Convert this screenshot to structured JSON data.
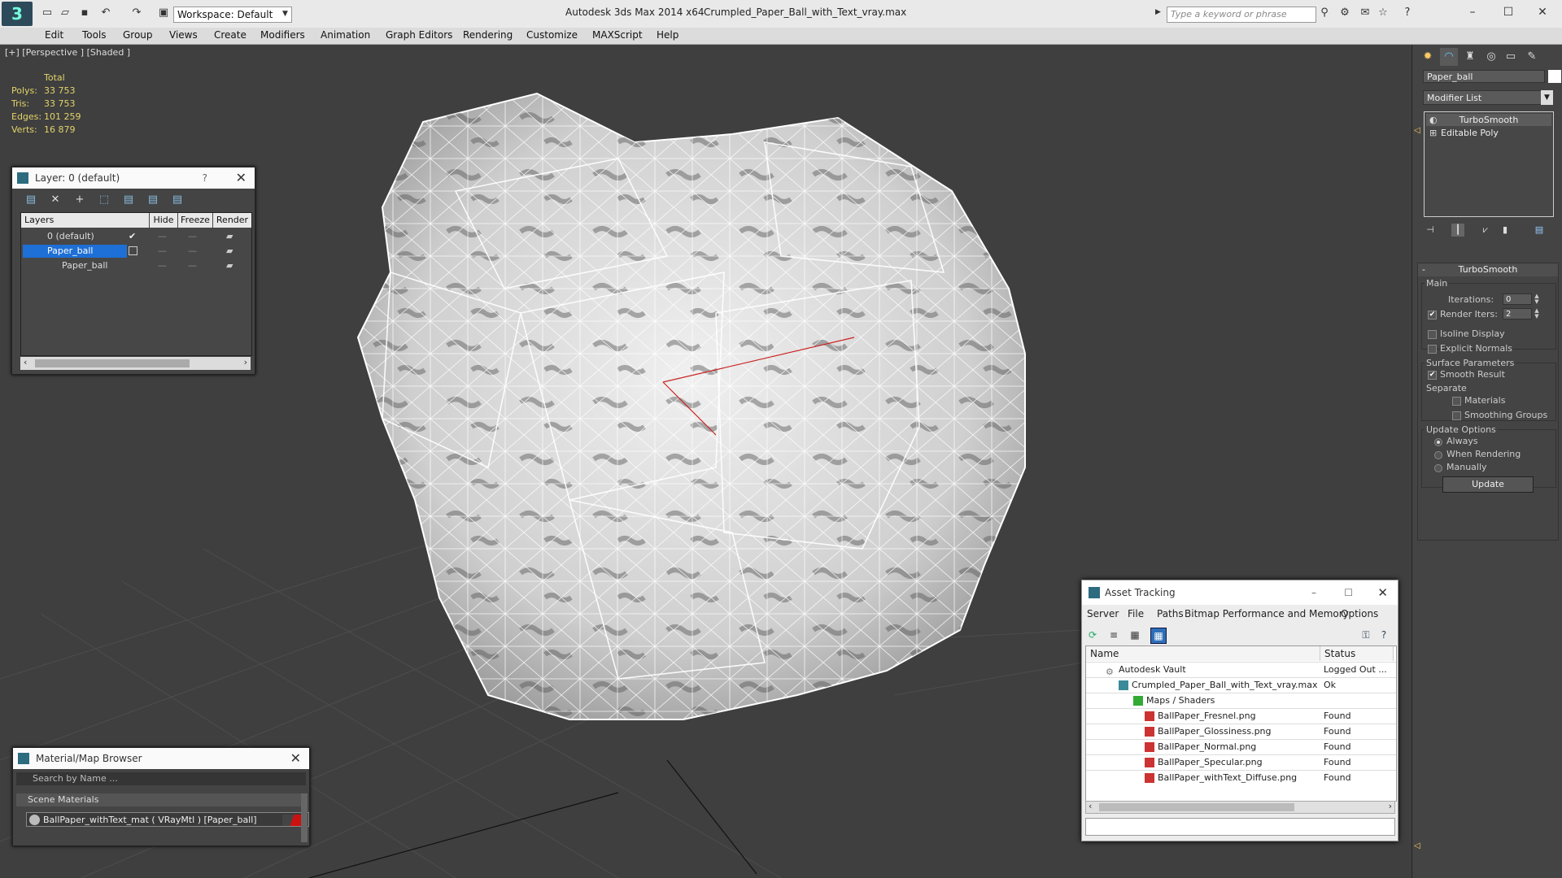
{
  "titlebar": {
    "workspace": "Workspace: Default",
    "app_name": "Autodesk 3ds Max  2014 x64",
    "file_name": "Crumpled_Paper_Ball_with_Text_vray.max",
    "search_placeholder": "Type a keyword or phrase"
  },
  "menu": [
    "Edit",
    "Tools",
    "Group",
    "Views",
    "Create",
    "Modifiers",
    "Animation",
    "Graph Editors",
    "Rendering",
    "Customize",
    "MAXScript",
    "Help"
  ],
  "viewport": {
    "label": "[+] [Perspective ] [Shaded ]",
    "stats_header": "Total",
    "stats": [
      {
        "k": "Polys:",
        "v": "33 753"
      },
      {
        "k": "Tris:",
        "v": "33 753"
      },
      {
        "k": "Edges:",
        "v": "101 259"
      },
      {
        "k": "Verts:",
        "v": "16 879"
      }
    ]
  },
  "layer_panel": {
    "title": "Layer: 0 (default)",
    "help": "?",
    "headers": {
      "layers": "Layers",
      "hide": "Hide",
      "freeze": "Freeze",
      "render": "Render"
    },
    "rows": [
      "0 (default)",
      "Paper_ball",
      "Paper_ball"
    ]
  },
  "material_browser": {
    "title": "Material/Map Browser",
    "search_placeholder": "Search by Name ...",
    "section": "Scene Materials",
    "item": "BallPaper_withText_mat  ( VRayMtl )  [Paper_ball]"
  },
  "asset_tracking": {
    "title": "Asset Tracking",
    "menu": [
      "Server",
      "File",
      "Paths",
      "Bitmap Performance and Memory",
      "Options"
    ],
    "headers": {
      "name": "Name",
      "status": "Status"
    },
    "rows": [
      {
        "name": "Autodesk Vault",
        "status": "Logged Out ..."
      },
      {
        "name": "Crumpled_Paper_Ball_with_Text_vray.max",
        "status": "Ok"
      },
      {
        "name": "Maps / Shaders",
        "status": ""
      },
      {
        "name": "BallPaper_Fresnel.png",
        "status": "Found"
      },
      {
        "name": "BallPaper_Glossiness.png",
        "status": "Found"
      },
      {
        "name": "BallPaper_Normal.png",
        "status": "Found"
      },
      {
        "name": "BallPaper_Specular.png",
        "status": "Found"
      },
      {
        "name": "BallPaper_withText_Diffuse.png",
        "status": "Found"
      }
    ]
  },
  "command_panel": {
    "object_name": "Paper_ball",
    "modifier_list": "Modifier List",
    "stack": [
      "TurboSmooth",
      "Editable Poly"
    ],
    "rollout_title": "TurboSmooth",
    "main_label": "Main",
    "iterations_label": "Iterations:",
    "iterations_value": "0",
    "render_iters_label": "Render Iters:",
    "render_iters_value": "2",
    "isoline_label": "Isoline Display",
    "explicit_normals_label": "Explicit Normals",
    "surface_params_label": "Surface Parameters",
    "smooth_result_label": "Smooth Result",
    "separate_label": "Separate",
    "materials_label": "Materials",
    "smoothing_groups_label": "Smoothing Groups",
    "update_options_label": "Update Options",
    "always_label": "Always",
    "when_rendering_label": "When Rendering",
    "manually_label": "Manually",
    "update_button": "Update"
  },
  "colors": {
    "accent": "#2d6b7f",
    "stats": "#e3d36a",
    "selection": "#1e6fd6"
  }
}
